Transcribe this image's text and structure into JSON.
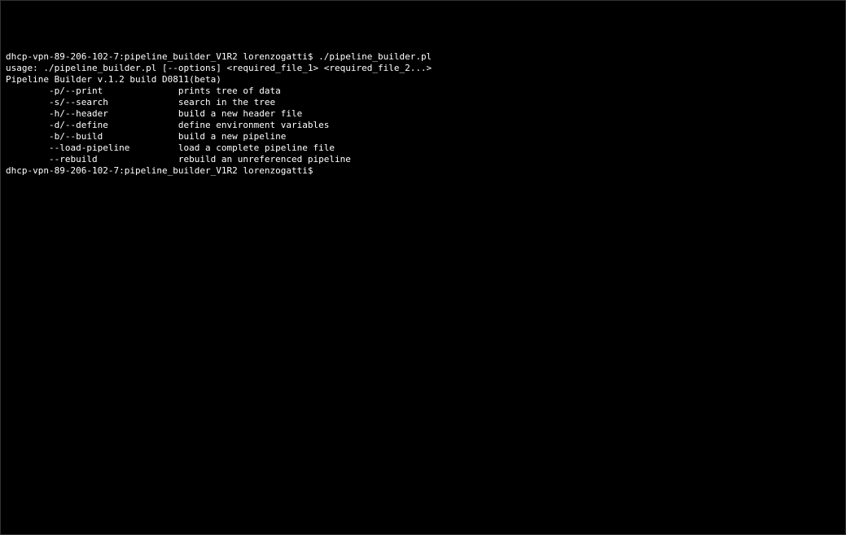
{
  "terminal": {
    "prompt_host": "dhcp-vpn-89-206-102-7:pipeline_builder_V1R2 lorenzogatti$ ",
    "command": "./pipeline_builder.pl",
    "usage_line": "usage: ./pipeline_builder.pl [--options] <required_file_1> <required_file_2...>",
    "blank": "",
    "version_line": "Pipeline Builder v.1.2 build D0811(beta)",
    "options": [
      {
        "flag": "-p/--print",
        "desc": "prints tree of data"
      },
      {
        "flag": "-s/--search",
        "desc": "search in the tree"
      },
      {
        "flag": "-h/--header",
        "desc": "build a new header file"
      },
      {
        "flag": "-d/--define",
        "desc": "define environment variables"
      },
      {
        "flag": "-b/--build",
        "desc": "build a new pipeline"
      },
      {
        "flag": "--load-pipeline",
        "desc": "load a complete pipeline file"
      },
      {
        "flag": "--rebuild",
        "desc": "rebuild an unreferenced pipeline"
      }
    ],
    "final_prompt": "dhcp-vpn-89-206-102-7:pipeline_builder_V1R2 lorenzogatti$ "
  },
  "layout": {
    "option_indent_spaces": "        ",
    "flag_column_width": 24
  }
}
